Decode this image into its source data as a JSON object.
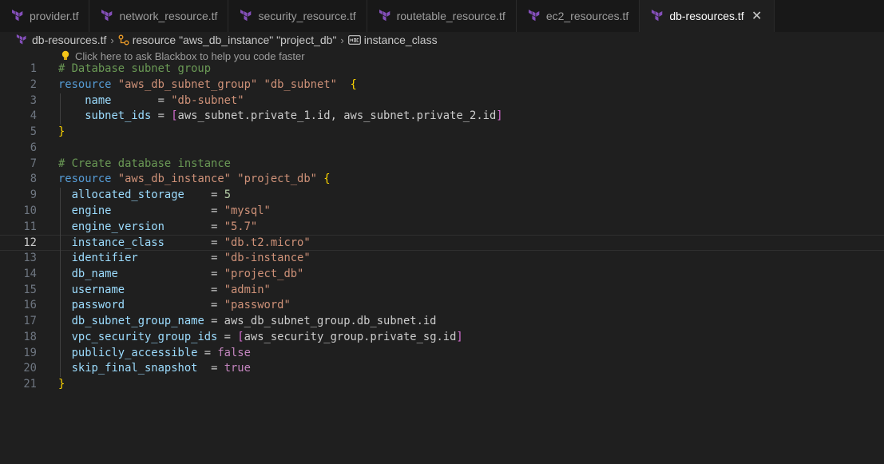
{
  "tabs": [
    {
      "label": "provider.tf",
      "active": false
    },
    {
      "label": "network_resource.tf",
      "active": false
    },
    {
      "label": "security_resource.tf",
      "active": false
    },
    {
      "label": "routetable_resource.tf",
      "active": false
    },
    {
      "label": "ec2_resources.tf",
      "active": false
    },
    {
      "label": "db-resources.tf",
      "active": true
    }
  ],
  "close_glyph": "✕",
  "breadcrumb": {
    "file": "db-resources.tf",
    "resource": "resource \"aws_db_instance\" \"project_db\"",
    "field": "instance_class"
  },
  "hint": "Click here to ask Blackbox to help you code faster",
  "colors": {
    "terraform_icon": "#844fba",
    "keyword": "#569cd6",
    "string": "#ce9178",
    "comment": "#6a9955",
    "number": "#b5cea8",
    "property": "#9cdcfe",
    "boolean": "#c586c0",
    "bracket_level1": "#ffd700",
    "bracket_level2": "#da70d6"
  },
  "current_line": 12,
  "lines": [
    {
      "n": "1",
      "tokens": [
        [
          "cm",
          "# Database subnet group"
        ]
      ]
    },
    {
      "n": "2",
      "tokens": [
        [
          "kw",
          "resource"
        ],
        [
          "plain",
          " "
        ],
        [
          "str",
          "\"aws_db_subnet_group\""
        ],
        [
          "plain",
          " "
        ],
        [
          "str",
          "\"db_subnet\""
        ],
        [
          "plain",
          "  "
        ],
        [
          "b1",
          "{"
        ]
      ]
    },
    {
      "n": "3",
      "tokens": [
        [
          "plain",
          "    "
        ],
        [
          "prop",
          "name"
        ],
        [
          "plain",
          "       = "
        ],
        [
          "str",
          "\"db-subnet\""
        ]
      ]
    },
    {
      "n": "4",
      "tokens": [
        [
          "plain",
          "    "
        ],
        [
          "prop",
          "subnet_ids"
        ],
        [
          "plain",
          " = "
        ],
        [
          "b2",
          "["
        ],
        [
          "plain",
          "aws_subnet.private_1.id, aws_subnet.private_2.id"
        ],
        [
          "b2",
          "]"
        ]
      ]
    },
    {
      "n": "5",
      "tokens": [
        [
          "b1",
          "}"
        ]
      ]
    },
    {
      "n": "6",
      "tokens": []
    },
    {
      "n": "7",
      "tokens": [
        [
          "cm",
          "# Create database instance"
        ]
      ]
    },
    {
      "n": "8",
      "tokens": [
        [
          "kw",
          "resource"
        ],
        [
          "plain",
          " "
        ],
        [
          "str",
          "\"aws_db_instance\""
        ],
        [
          "plain",
          " "
        ],
        [
          "str",
          "\"project_db\""
        ],
        [
          "plain",
          " "
        ],
        [
          "b1",
          "{"
        ]
      ]
    },
    {
      "n": "9",
      "tokens": [
        [
          "plain",
          "  "
        ],
        [
          "prop",
          "allocated_storage"
        ],
        [
          "plain",
          "    = "
        ],
        [
          "num",
          "5"
        ]
      ]
    },
    {
      "n": "10",
      "tokens": [
        [
          "plain",
          "  "
        ],
        [
          "prop",
          "engine"
        ],
        [
          "plain",
          "               = "
        ],
        [
          "str",
          "\"mysql\""
        ]
      ]
    },
    {
      "n": "11",
      "tokens": [
        [
          "plain",
          "  "
        ],
        [
          "prop",
          "engine_version"
        ],
        [
          "plain",
          "       = "
        ],
        [
          "str",
          "\"5.7\""
        ]
      ]
    },
    {
      "n": "12",
      "tokens": [
        [
          "plain",
          "  "
        ],
        [
          "prop",
          "instance_class"
        ],
        [
          "plain",
          "       = "
        ],
        [
          "str",
          "\"db.t2.micro\""
        ]
      ]
    },
    {
      "n": "13",
      "tokens": [
        [
          "plain",
          "  "
        ],
        [
          "prop",
          "identifier"
        ],
        [
          "plain",
          "           = "
        ],
        [
          "str",
          "\"db-instance\""
        ]
      ]
    },
    {
      "n": "14",
      "tokens": [
        [
          "plain",
          "  "
        ],
        [
          "prop",
          "db_name"
        ],
        [
          "plain",
          "              = "
        ],
        [
          "str",
          "\"project_db\""
        ]
      ]
    },
    {
      "n": "15",
      "tokens": [
        [
          "plain",
          "  "
        ],
        [
          "prop",
          "username"
        ],
        [
          "plain",
          "             = "
        ],
        [
          "str",
          "\"admin\""
        ]
      ]
    },
    {
      "n": "16",
      "tokens": [
        [
          "plain",
          "  "
        ],
        [
          "prop",
          "password"
        ],
        [
          "plain",
          "             = "
        ],
        [
          "str",
          "\"password\""
        ]
      ]
    },
    {
      "n": "17",
      "tokens": [
        [
          "plain",
          "  "
        ],
        [
          "prop",
          "db_subnet_group_name"
        ],
        [
          "plain",
          " = aws_db_subnet_group.db_subnet.id"
        ]
      ]
    },
    {
      "n": "18",
      "tokens": [
        [
          "plain",
          "  "
        ],
        [
          "prop",
          "vpc_security_group_ids"
        ],
        [
          "plain",
          " = "
        ],
        [
          "b2",
          "["
        ],
        [
          "plain",
          "aws_security_group.private_sg.id"
        ],
        [
          "b2",
          "]"
        ]
      ]
    },
    {
      "n": "19",
      "tokens": [
        [
          "plain",
          "  "
        ],
        [
          "prop",
          "publicly_accessible"
        ],
        [
          "plain",
          " = "
        ],
        [
          "bool",
          "false"
        ]
      ]
    },
    {
      "n": "20",
      "tokens": [
        [
          "plain",
          "  "
        ],
        [
          "prop",
          "skip_final_snapshot"
        ],
        [
          "plain",
          "  = "
        ],
        [
          "bool",
          "true"
        ]
      ]
    },
    {
      "n": "21",
      "tokens": [
        [
          "b1",
          "}"
        ]
      ]
    }
  ]
}
